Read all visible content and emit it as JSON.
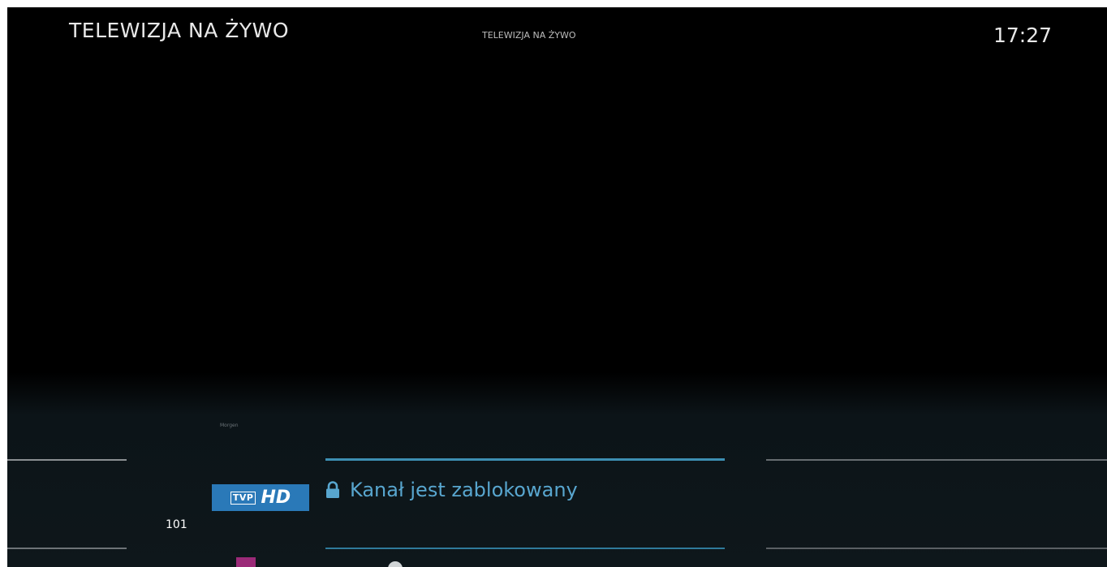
{
  "header": {
    "title": "TELEWIZJA NA ŻYWO",
    "subtitle": "TELEWIZJA NA ŻYWO",
    "clock": "17:27"
  },
  "guide": {
    "time_label": "Morgen",
    "current_channel": {
      "number": "101",
      "logo_tvp": "TVP",
      "logo_hd": "HD",
      "program_title": "Kanał jest zablokowany",
      "status_icon": "lock-icon"
    }
  },
  "colors": {
    "background": "#000000",
    "accent": "#58a6cf",
    "logo_bg": "#2a79b8"
  }
}
